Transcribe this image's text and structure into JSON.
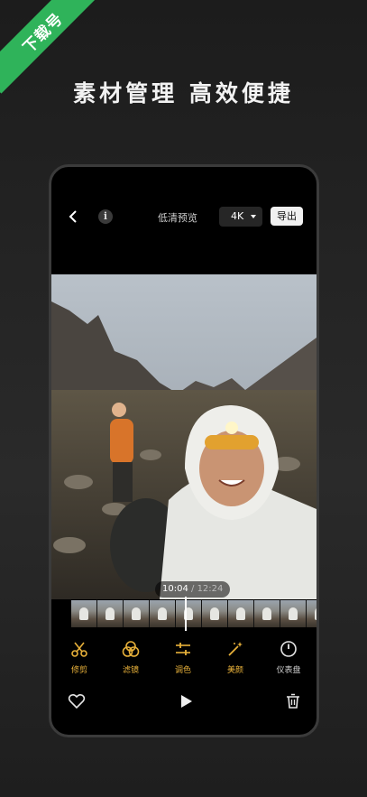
{
  "banner": {
    "text": "下载号"
  },
  "headline": "素材管理 高效便捷",
  "topbar": {
    "info_glyph": "i",
    "preview_label": "低清预览",
    "resolution": "4K",
    "export_label": "导出"
  },
  "playback": {
    "current": "10:04",
    "separator": " / ",
    "total": "12:24"
  },
  "tools": [
    {
      "label": "修剪",
      "icon": "scissors-icon"
    },
    {
      "label": "滤镜",
      "icon": "filter-circles-icon"
    },
    {
      "label": "调色",
      "icon": "sliders-icon"
    },
    {
      "label": "美颜",
      "icon": "magic-wand-icon"
    },
    {
      "label": "仪表盘",
      "icon": "gauge-icon"
    }
  ],
  "bottom_actions": [
    "heart-icon",
    "play-icon",
    "trash-icon"
  ],
  "colors": {
    "accent": "#e8b13a",
    "banner": "#2fb35a",
    "background": "#222222"
  }
}
